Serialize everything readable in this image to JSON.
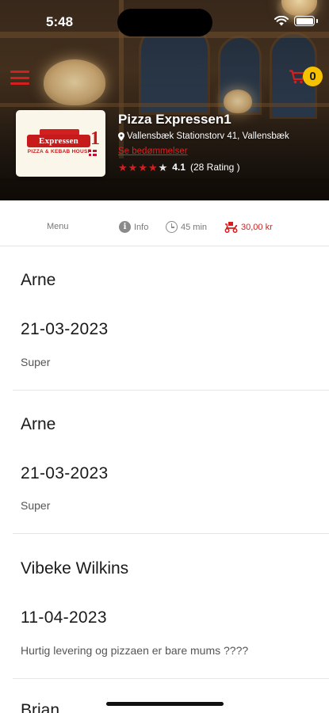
{
  "status_bar": {
    "time": "5:48"
  },
  "header": {
    "cart_count": "0",
    "restaurant": {
      "name": "Pizza Expressen1",
      "address": "Vallensbæk Stationstorv 41, Vallensbæk",
      "reviews_link": "Se bedømmelser",
      "rating_value": "4.1",
      "rating_count": "(28 Rating )",
      "stars_filled": 4,
      "stars_total": 5
    },
    "logo": {
      "top_text": "SINCE",
      "main_text": "Expressen",
      "number": "1",
      "sub_text": "PIZZA & KEBAB HOUSE"
    }
  },
  "info_bar": {
    "menu_label": "Menu",
    "info_label": "Info",
    "delivery_time": "45 min",
    "delivery_fee": "30,00 kr"
  },
  "reviews": [
    {
      "name": "Arne",
      "date": "21-03-2023",
      "text": "Super"
    },
    {
      "name": "Arne",
      "date": "21-03-2023",
      "text": "Super"
    },
    {
      "name": "Vibeke Wilkins",
      "date": "11-04-2023",
      "text": "Hurtig levering og pizzaen er bare mums ????"
    },
    {
      "name": "Brian",
      "date": "",
      "text": ""
    }
  ],
  "colors": {
    "accent_red": "#d21f1f",
    "badge_yellow": "#f6c200",
    "muted_text": "#777777"
  }
}
